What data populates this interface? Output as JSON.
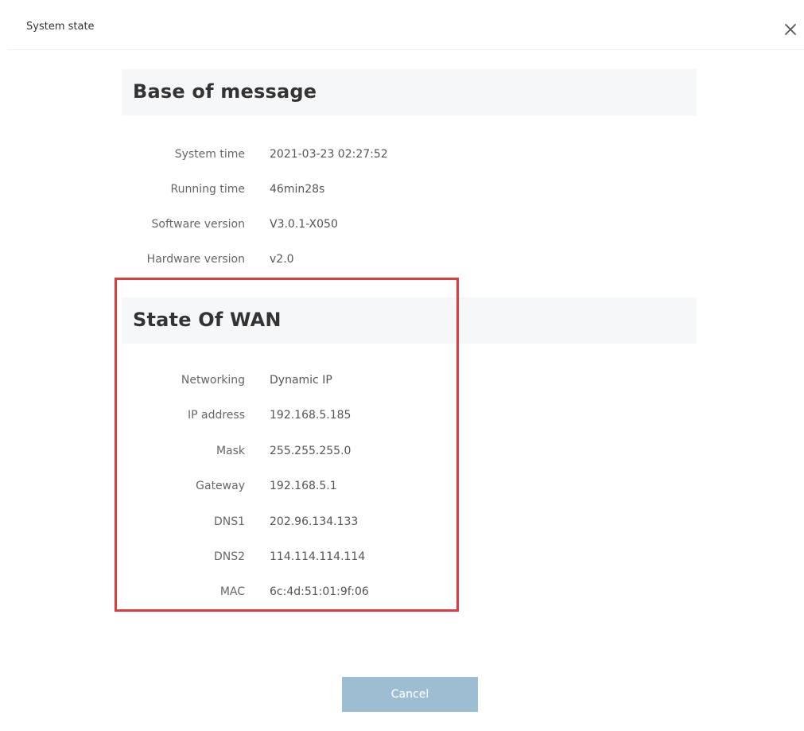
{
  "window": {
    "title": "System state",
    "close_icon": "close-icon"
  },
  "base_section": {
    "title": "Base of message",
    "rows": [
      {
        "label": "System time",
        "value": "2021-03-23 02:27:52"
      },
      {
        "label": "Running time",
        "value": "46min28s"
      },
      {
        "label": "Software version",
        "value": "V3.0.1-X050"
      },
      {
        "label": "Hardware version",
        "value": "v2.0"
      }
    ]
  },
  "wan_section": {
    "title": "State Of WAN",
    "rows": [
      {
        "label": "Networking",
        "value": "Dynamic IP"
      },
      {
        "label": "IP address",
        "value": "192.168.5.185"
      },
      {
        "label": "Mask",
        "value": "255.255.255.0"
      },
      {
        "label": "Gateway",
        "value": "192.168.5.1"
      },
      {
        "label": "DNS1",
        "value": "202.96.134.133"
      },
      {
        "label": "DNS2",
        "value": "114.114.114.114"
      },
      {
        "label": "MAC",
        "value": "6c:4d:51:01:9f:06"
      }
    ]
  },
  "footer": {
    "cancel_label": "Cancel"
  },
  "colors": {
    "highlight_border": "#e03c3c",
    "cancel_button": "#9dbdd3",
    "section_header_bg": "#f6f7f9"
  }
}
